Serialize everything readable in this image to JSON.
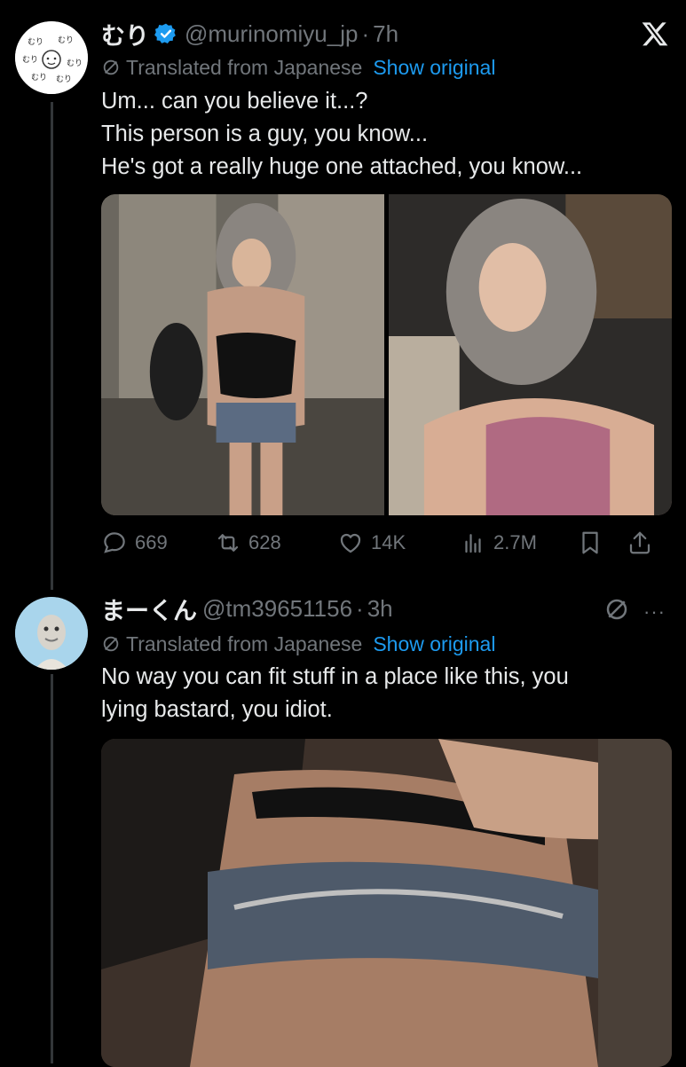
{
  "tweet1": {
    "name": "むり",
    "handle": "@murinomiyu_jp",
    "separator": "·",
    "time": "7h",
    "translated_label": "Translated from Japanese",
    "show_original": "Show original",
    "text_lines": [
      "Um... can you believe it...?",
      "This person is a guy, you know...",
      "He's got a really huge one attached, you know..."
    ],
    "avatar_text": "むり むり",
    "actions": {
      "replies": "669",
      "reposts": "628",
      "likes": "14K",
      "views": "2.7M"
    }
  },
  "tweet2": {
    "name": "まーくん",
    "handle": "@tm39651156",
    "separator": "·",
    "time": "3h",
    "translated_label": "Translated from Japanese",
    "show_original": "Show original",
    "text_lines": [
      "No way you can fit stuff in a place like this, you",
      "lying bastard, you idiot."
    ],
    "more": "···"
  },
  "colors": {
    "background": "#000000",
    "text": "#e7e9ea",
    "muted": "#71767b",
    "accent": "#1d9bf0"
  }
}
